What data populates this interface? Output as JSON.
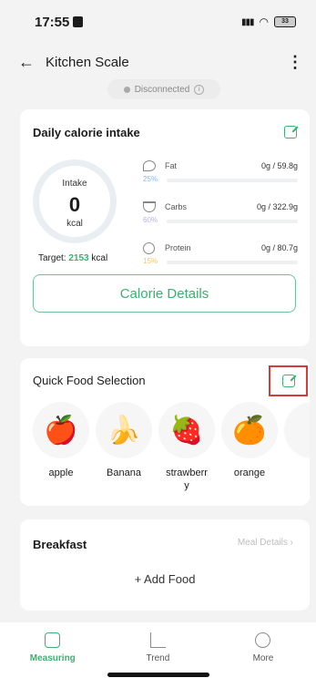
{
  "status_bar": {
    "time": "17:55",
    "battery": "33"
  },
  "header": {
    "back_icon": "arrow-left-icon",
    "title": "Kitchen Scale",
    "menu_icon": "more-vertical-icon"
  },
  "connection": {
    "status": "Disconnected"
  },
  "calorie_card": {
    "title": "Daily calorie intake",
    "intake_label": "Intake",
    "intake_value": "0",
    "intake_unit": "kcal",
    "target_label": "Target:",
    "target_value": "2153",
    "target_unit": "kcal",
    "macros": [
      {
        "name": "Fat",
        "percent": "25%",
        "amount": "0g / 59.8g",
        "color": "#8fb5e8",
        "icon": "drumstick-icon"
      },
      {
        "name": "Carbs",
        "percent": "60%",
        "amount": "0g / 322.9g",
        "color": "#b8b4e6",
        "icon": "bowl-icon"
      },
      {
        "name": "Protein",
        "percent": "15%",
        "amount": "0g / 80.7g",
        "color": "#f0c77a",
        "icon": "egg-icon"
      }
    ],
    "details_button": "Calorie Details"
  },
  "quick_food": {
    "title": "Quick Food Selection",
    "items": [
      {
        "name": "apple",
        "emoji": "🍎"
      },
      {
        "name": "Banana",
        "emoji": "🍌"
      },
      {
        "name": "strawberr y",
        "emoji": "🍓"
      },
      {
        "name": "orange",
        "emoji": "🍊"
      }
    ]
  },
  "breakfast": {
    "title": "Breakfast",
    "link": "Meal Details",
    "add_food": "+ Add Food"
  },
  "tabs": [
    {
      "label": "Measuring",
      "icon": "scale-icon",
      "active": true
    },
    {
      "label": "Trend",
      "icon": "chart-icon",
      "active": false
    },
    {
      "label": "More",
      "icon": "more-circle-icon",
      "active": false
    }
  ],
  "colors": {
    "accent": "#3fae6f",
    "highlight": "#d83a3a"
  }
}
